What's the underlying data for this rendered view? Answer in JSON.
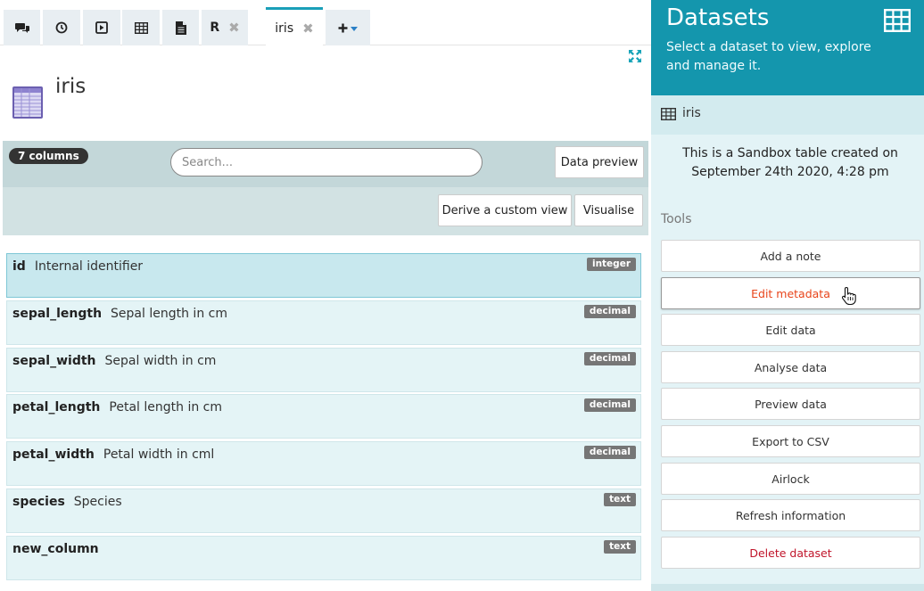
{
  "tabs": [
    {
      "icon": "comments-icon",
      "label": ""
    },
    {
      "icon": "clock-icon",
      "label": ""
    },
    {
      "icon": "play-icon",
      "label": ""
    },
    {
      "icon": "table-icon",
      "label": ""
    },
    {
      "icon": "document-icon",
      "label": ""
    },
    {
      "icon": "",
      "label": "R",
      "closable": true
    },
    {
      "icon": "",
      "label": "iris",
      "closable": true,
      "active": true
    },
    {
      "icon": "plus-icon",
      "label": "",
      "dropdown": true
    }
  ],
  "tab_close_glyph": "✖",
  "page": {
    "title": "iris"
  },
  "toolbar": {
    "column_count": "7 columns",
    "search_placeholder": "Search...",
    "data_preview": "Data preview",
    "derive_custom_view": "Derive a custom view",
    "visualise": "Visualise"
  },
  "columns": [
    {
      "name": "id",
      "description": "Internal identifier",
      "type": "integer",
      "selected": true
    },
    {
      "name": "sepal_length",
      "description": "Sepal length in cm",
      "type": "decimal"
    },
    {
      "name": "sepal_width",
      "description": "Sepal width in cm",
      "type": "decimal"
    },
    {
      "name": "petal_length",
      "description": "Petal length in cm",
      "type": "decimal"
    },
    {
      "name": "petal_width",
      "description": "Petal width in cml",
      "type": "decimal"
    },
    {
      "name": "species",
      "description": "Species",
      "type": "text"
    },
    {
      "name": "new_column",
      "description": "",
      "type": "text"
    }
  ],
  "panel": {
    "title": "Datasets",
    "subtitle": "Select a dataset to view, explore and manage it.",
    "dataset_name": "iris",
    "dataset_description": "This is a Sandbox table created on September 24th 2020, 4:28 pm",
    "tools_label": "Tools",
    "tools": [
      {
        "label": "Add a note",
        "style": "normal"
      },
      {
        "label": "Edit metadata",
        "style": "orange"
      },
      {
        "label": "Edit data",
        "style": "normal"
      },
      {
        "label": "Analyse data",
        "style": "normal"
      },
      {
        "label": "Preview data",
        "style": "normal"
      },
      {
        "label": "Export to CSV",
        "style": "normal"
      },
      {
        "label": "Airlock",
        "style": "normal"
      },
      {
        "label": "Refresh information",
        "style": "normal"
      },
      {
        "label": "Delete dataset",
        "style": "danger"
      }
    ]
  },
  "colors": {
    "accent": "#1496ad",
    "panel_bg": "#e3f3f6",
    "edit_metadata": "#e8441a",
    "delete": "#c0142a"
  }
}
